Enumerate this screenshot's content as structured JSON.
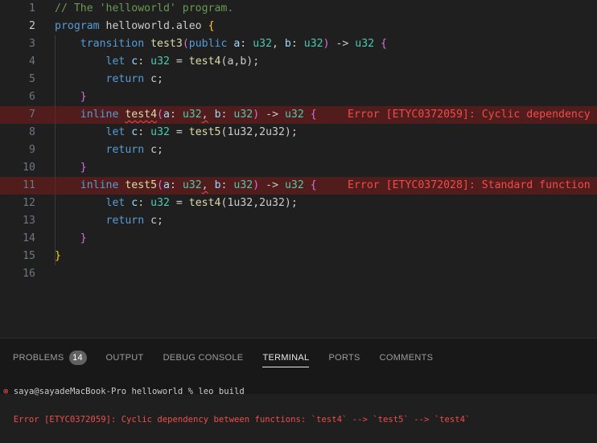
{
  "editor": {
    "lines": [
      {
        "num": "1",
        "segs": [
          {
            "c": "c",
            "t": "// The 'helloworld' program."
          }
        ]
      },
      {
        "num": "2",
        "segs": [
          {
            "c": "k",
            "t": "program "
          },
          {
            "c": "",
            "t": "helloworld.aleo "
          },
          {
            "c": "b1",
            "t": "{"
          }
        ]
      },
      {
        "num": "3",
        "segs": [
          {
            "c": "",
            "t": "    "
          },
          {
            "c": "k",
            "t": "transition "
          },
          {
            "c": "f",
            "t": "test3"
          },
          {
            "c": "b2",
            "t": "("
          },
          {
            "c": "k",
            "t": "public "
          },
          {
            "c": "v",
            "t": "a"
          },
          {
            "c": "",
            "t": ": "
          },
          {
            "c": "t",
            "t": "u32"
          },
          {
            "c": "",
            "t": ", "
          },
          {
            "c": "v",
            "t": "b"
          },
          {
            "c": "",
            "t": ": "
          },
          {
            "c": "t",
            "t": "u32"
          },
          {
            "c": "b2",
            "t": ")"
          },
          {
            "c": "",
            "t": " -> "
          },
          {
            "c": "t",
            "t": "u32"
          },
          {
            "c": "",
            "t": " "
          },
          {
            "c": "b2",
            "t": "{"
          }
        ]
      },
      {
        "num": "4",
        "segs": [
          {
            "c": "",
            "t": "        "
          },
          {
            "c": "k",
            "t": "let "
          },
          {
            "c": "v",
            "t": "c"
          },
          {
            "c": "",
            "t": ": "
          },
          {
            "c": "t",
            "t": "u32"
          },
          {
            "c": "",
            "t": " = "
          },
          {
            "c": "f",
            "t": "test4"
          },
          {
            "c": "",
            "t": "(a,b);"
          }
        ]
      },
      {
        "num": "5",
        "segs": [
          {
            "c": "",
            "t": "        "
          },
          {
            "c": "k",
            "t": "return "
          },
          {
            "c": "",
            "t": "c;"
          }
        ]
      },
      {
        "num": "6",
        "segs": [
          {
            "c": "",
            "t": "    "
          },
          {
            "c": "b2",
            "t": "}"
          }
        ]
      },
      {
        "num": "7",
        "error": true,
        "segs": [
          {
            "c": "",
            "t": "    "
          },
          {
            "c": "k",
            "t": "inline "
          },
          {
            "c": "f squig",
            "t": "test4"
          },
          {
            "c": "b2",
            "t": "("
          },
          {
            "c": "v",
            "t": "a"
          },
          {
            "c": "",
            "t": ": "
          },
          {
            "c": "t",
            "t": "u32"
          },
          {
            "c": "squig",
            "t": ","
          },
          {
            "c": "",
            "t": " "
          },
          {
            "c": "v",
            "t": "b"
          },
          {
            "c": "",
            "t": ": "
          },
          {
            "c": "t",
            "t": "u32"
          },
          {
            "c": "b2",
            "t": ")"
          },
          {
            "c": "",
            "t": " -> "
          },
          {
            "c": "t",
            "t": "u32"
          },
          {
            "c": "",
            "t": " "
          },
          {
            "c": "b2",
            "t": "{"
          }
        ],
        "err": "Error [ETYC0372059]: Cyclic dependency"
      },
      {
        "num": "8",
        "segs": [
          {
            "c": "",
            "t": "        "
          },
          {
            "c": "k",
            "t": "let "
          },
          {
            "c": "v",
            "t": "c"
          },
          {
            "c": "",
            "t": ": "
          },
          {
            "c": "t",
            "t": "u32"
          },
          {
            "c": "",
            "t": " = "
          },
          {
            "c": "f",
            "t": "test5"
          },
          {
            "c": "",
            "t": "(1u32,2u32);"
          }
        ]
      },
      {
        "num": "9",
        "segs": [
          {
            "c": "",
            "t": "        "
          },
          {
            "c": "k",
            "t": "return "
          },
          {
            "c": "",
            "t": "c;"
          }
        ]
      },
      {
        "num": "10",
        "segs": [
          {
            "c": "",
            "t": "    "
          },
          {
            "c": "b2",
            "t": "}"
          }
        ]
      },
      {
        "num": "11",
        "error": true,
        "segs": [
          {
            "c": "",
            "t": "    "
          },
          {
            "c": "k",
            "t": "inline "
          },
          {
            "c": "f",
            "t": "test5"
          },
          {
            "c": "b2",
            "t": "("
          },
          {
            "c": "v",
            "t": "a"
          },
          {
            "c": "",
            "t": ": "
          },
          {
            "c": "t",
            "t": "u32"
          },
          {
            "c": "squig",
            "t": ","
          },
          {
            "c": "",
            "t": " "
          },
          {
            "c": "v",
            "t": "b"
          },
          {
            "c": "",
            "t": ": "
          },
          {
            "c": "t",
            "t": "u32"
          },
          {
            "c": "b2",
            "t": ")"
          },
          {
            "c": "",
            "t": " -> "
          },
          {
            "c": "t",
            "t": "u32"
          },
          {
            "c": "",
            "t": " "
          },
          {
            "c": "b2",
            "t": "{"
          }
        ],
        "err": "Error [ETYC0372028]: Standard function"
      },
      {
        "num": "12",
        "segs": [
          {
            "c": "",
            "t": "        "
          },
          {
            "c": "k",
            "t": "let "
          },
          {
            "c": "v",
            "t": "c"
          },
          {
            "c": "",
            "t": ": "
          },
          {
            "c": "t",
            "t": "u32"
          },
          {
            "c": "",
            "t": " = "
          },
          {
            "c": "f",
            "t": "test4"
          },
          {
            "c": "",
            "t": "(1u32,2u32);"
          }
        ]
      },
      {
        "num": "13",
        "segs": [
          {
            "c": "",
            "t": "        "
          },
          {
            "c": "k",
            "t": "return "
          },
          {
            "c": "",
            "t": "c;"
          }
        ]
      },
      {
        "num": "14",
        "segs": [
          {
            "c": "",
            "t": "    "
          },
          {
            "c": "b2",
            "t": "}"
          }
        ]
      },
      {
        "num": "15",
        "segs": [
          {
            "c": "b1",
            "t": "}"
          }
        ]
      },
      {
        "num": "16",
        "segs": []
      }
    ],
    "active_line": "2"
  },
  "panel": {
    "tabs": [
      {
        "label": "PROBLEMS",
        "badge": "14"
      },
      {
        "label": "OUTPUT"
      },
      {
        "label": "DEBUG CONSOLE"
      },
      {
        "label": "TERMINAL",
        "active": true
      },
      {
        "label": "PORTS"
      },
      {
        "label": "COMMENTS"
      }
    ],
    "terminal": {
      "error_icon": "error-circle-icon",
      "prompt": "saya@sayadeMacBook-Pro helloworld % leo build",
      "error": "Error [ETYC0372059]: Cyclic dependency between functions: `test4` --> `test5` --> `test4`"
    }
  },
  "colors": {
    "background": "#1f1f1f",
    "error": "#f14c4c",
    "keyword": "#569cd6",
    "type": "#4ec9b0"
  }
}
